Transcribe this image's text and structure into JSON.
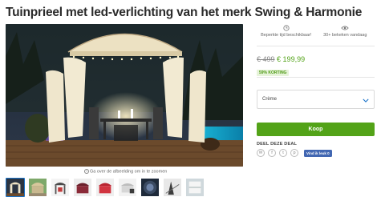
{
  "product": {
    "title": "Tuinprieel met led-verlichting van het merk Swing & Harmonie"
  },
  "gallery": {
    "zoom_hint": "Ga over de afbeelding om in te zoomen",
    "thumbnails": [
      "thumb-1",
      "thumb-2",
      "thumb-3",
      "thumb-4",
      "thumb-5",
      "thumb-6",
      "thumb-7",
      "thumb-8",
      "thumb-9"
    ]
  },
  "stats": {
    "availability": "Beperkte tijd beschikbaar!",
    "views": "30+ bekeken vandaag"
  },
  "pricing": {
    "old_price": "€ 499",
    "new_price": "€ 199,99",
    "discount": "59% KORTING"
  },
  "variant": {
    "selected": "Crème"
  },
  "actions": {
    "buy_label": "Koop"
  },
  "share": {
    "label": "DEEL DEZE DEAL",
    "fb_like_label": "Vind ik leuk 0"
  },
  "colors": {
    "accent_green": "#53a318",
    "facebook_blue": "#4267b2",
    "select_chevron": "#1a73c9"
  },
  "icons": {
    "availability": "clock-icon",
    "views": "eye-icon",
    "chevron": "chevron-down-icon",
    "share": [
      "email-icon",
      "facebook-icon",
      "twitter-icon",
      "pinterest-icon"
    ]
  }
}
